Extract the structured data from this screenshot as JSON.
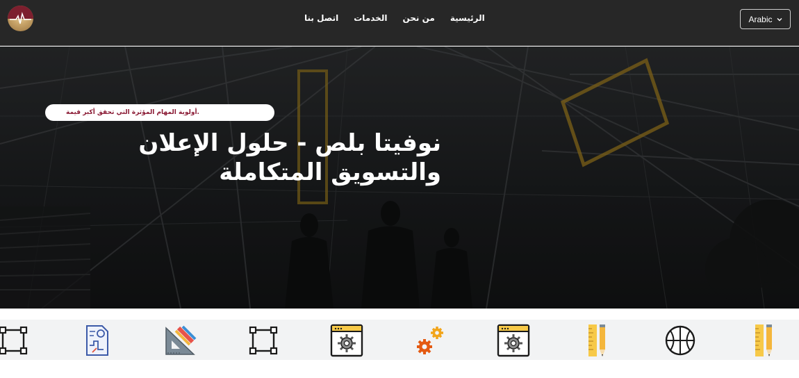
{
  "navbar": {
    "logo": "brand-logo",
    "links": [
      {
        "label": "اتصل بنا",
        "name": "nav-contact"
      },
      {
        "label": "الخدمات",
        "name": "nav-services"
      },
      {
        "label": "من نحن",
        "name": "nav-about"
      },
      {
        "label": "الرئيسية",
        "name": "nav-home"
      }
    ],
    "language": {
      "label": "Arabic",
      "icon": "chevron-down-icon"
    }
  },
  "hero": {
    "tagline": ".أولوية المهام المؤثرة التي تحقق أكبر قيمة",
    "title": "نوفيتا بلص - حلول الإعلان والتسويق المتكاملة"
  },
  "services": {
    "icons": [
      "bounding-box-icon",
      "blueprint-chart-icon",
      "drafting-tools-icon",
      "bounding-box-icon",
      "browser-gear-icon",
      "orange-gears-icon",
      "browser-gear-icon",
      "ruler-pencil-icon",
      "basketball-icon",
      "ruler-pencil-icon"
    ]
  },
  "colors": {
    "navbar_bg": "#272727",
    "brand_maroon": "#7d1f2e",
    "tagline_text": "#8a1a34",
    "services_bg": "#f2f3f4",
    "accent_orange": "#f28b1b",
    "accent_yellow": "#f7c948"
  }
}
